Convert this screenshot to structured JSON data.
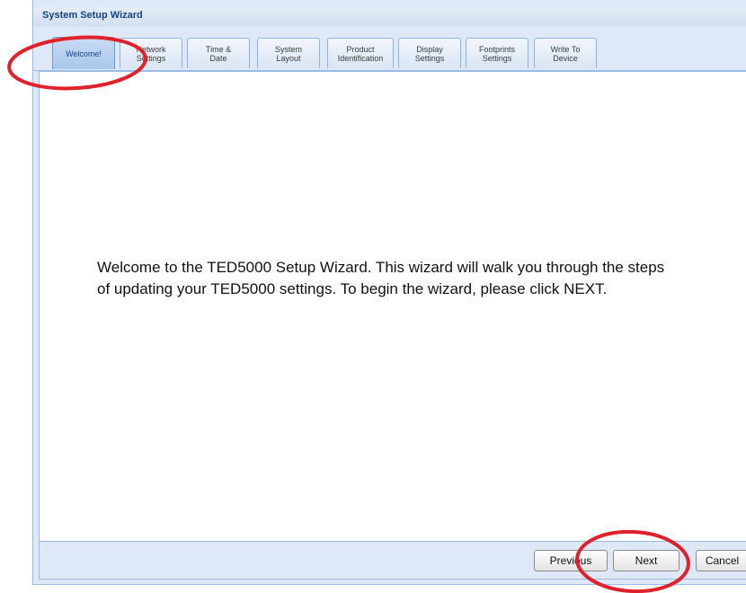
{
  "window": {
    "title": "System Setup Wizard"
  },
  "tabs": [
    {
      "label": "Welcome!",
      "active": true
    },
    {
      "label": "Network\nSettings",
      "active": false
    },
    {
      "label": "Time &\nDate",
      "active": false
    },
    {
      "label": "System\nLayout",
      "active": false
    },
    {
      "label": "Product\nIdentification",
      "active": false
    },
    {
      "label": "Display\nSettings",
      "active": false
    },
    {
      "label": "Footprints\nSettings",
      "active": false
    },
    {
      "label": "Write To\nDevice",
      "active": false
    }
  ],
  "content": {
    "welcome_text": "Welcome to the TED5000 Setup Wizard. This wizard will walk you through the steps of updating your TED5000 settings. To begin the wizard, please click NEXT."
  },
  "buttons": {
    "previous": "Previous",
    "next": "Next",
    "cancel": "Cancel"
  },
  "annotation_color": "#e0202a"
}
